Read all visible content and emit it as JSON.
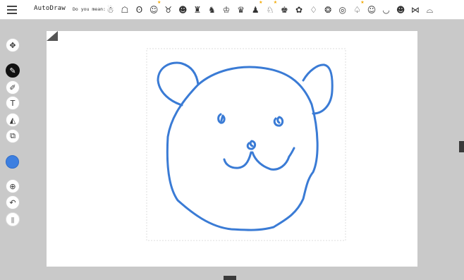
{
  "header": {
    "app_title": "AutoDraw",
    "suggestion_label": "Do you mean:",
    "suggestions": [
      {
        "icon": "gingerbread-man-icon",
        "glyph": "☃",
        "featured": false
      },
      {
        "icon": "robot-icon",
        "glyph": "☖",
        "featured": false
      },
      {
        "icon": "teddy-bear-icon",
        "glyph": "ʘ",
        "featured": false
      },
      {
        "icon": "bear-face-icon",
        "glyph": "☺",
        "featured": true
      },
      {
        "icon": "pig-icon",
        "glyph": "♉",
        "featured": false
      },
      {
        "icon": "cat-face-icon",
        "glyph": "☻",
        "featured": false
      },
      {
        "icon": "figure-icon",
        "glyph": "♜",
        "featured": false
      },
      {
        "icon": "elephant-icon",
        "glyph": "♞",
        "featured": false
      },
      {
        "icon": "monkey-face-icon",
        "glyph": "♔",
        "featured": false
      },
      {
        "icon": "owl-icon",
        "glyph": "♛",
        "featured": false
      },
      {
        "icon": "penguin-icon",
        "glyph": "♟",
        "featured": true
      },
      {
        "icon": "dog-icon",
        "glyph": "♘",
        "featured": true
      },
      {
        "icon": "lion-face-icon",
        "glyph": "♚",
        "featured": false
      },
      {
        "icon": "bug-icon",
        "glyph": "✿",
        "featured": false
      },
      {
        "icon": "pear-icon",
        "glyph": "♢",
        "featured": false
      },
      {
        "icon": "cookie-icon",
        "glyph": "❂",
        "featured": false
      },
      {
        "icon": "coin-icon",
        "glyph": "◎",
        "featured": false
      },
      {
        "icon": "potted-plant-icon",
        "glyph": "♤",
        "featured": true
      },
      {
        "icon": "smiley-face-icon",
        "glyph": "☺",
        "featured": false
      },
      {
        "icon": "lips-icon",
        "glyph": "◡",
        "featured": false
      },
      {
        "icon": "happy-face-icon",
        "glyph": "☻",
        "featured": false
      },
      {
        "icon": "butterfly-icon",
        "glyph": "⋈",
        "featured": false
      },
      {
        "icon": "hat-icon",
        "glyph": "⌓",
        "featured": false
      }
    ]
  },
  "toolbar": {
    "tools": [
      {
        "name": "move-tool",
        "icon": "move-arrows-icon",
        "glyph": "✥",
        "active": false,
        "disabled": false
      },
      {
        "name": "autodraw-tool",
        "icon": "autodraw-sparkle-icon",
        "glyph": "✎",
        "active": true,
        "disabled": false
      },
      {
        "name": "draw-tool",
        "icon": "pen-icon",
        "glyph": "✐",
        "active": false,
        "disabled": false
      },
      {
        "name": "type-tool",
        "icon": "text-icon",
        "glyph": "T",
        "active": false,
        "disabled": false
      },
      {
        "name": "fill-tool",
        "icon": "fill-bucket-icon",
        "glyph": "◭",
        "active": false,
        "disabled": false
      },
      {
        "name": "shape-tool",
        "icon": "shapes-icon",
        "glyph": "⧉",
        "active": false,
        "disabled": false
      },
      {
        "name": "zoom-tool",
        "icon": "zoom-icon",
        "glyph": "⊕",
        "active": false,
        "disabled": false
      },
      {
        "name": "undo-tool",
        "icon": "undo-icon",
        "glyph": "↶",
        "active": false,
        "disabled": false
      },
      {
        "name": "delete-tool",
        "icon": "trash-icon",
        "glyph": "▮",
        "active": false,
        "disabled": true
      }
    ],
    "current_color": "#3d7fe0"
  },
  "colors": {
    "stroke": "#3a7bd5",
    "star": "#f2a800",
    "active_tool": "#111111"
  }
}
